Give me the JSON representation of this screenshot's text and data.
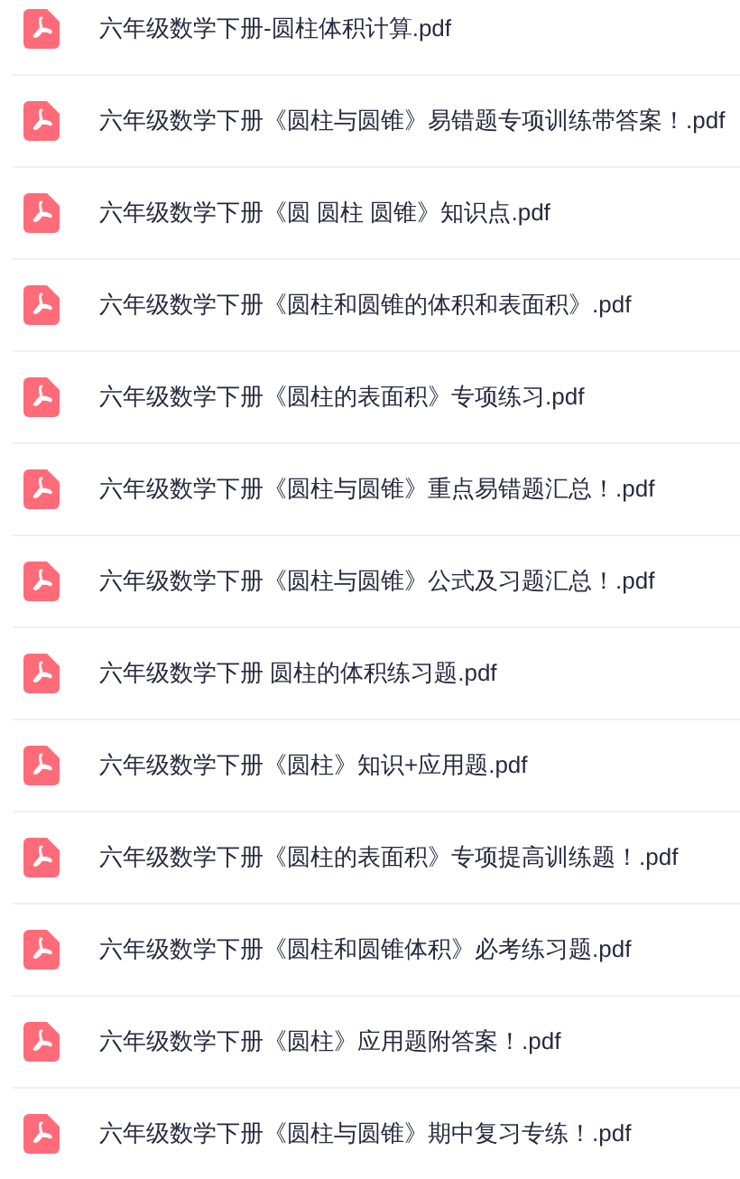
{
  "files": [
    {
      "name": "六年级数学下册-圆柱体积计算.pdf"
    },
    {
      "name": "六年级数学下册《圆柱与圆锥》易错题专项训练带答案！.pdf"
    },
    {
      "name": "六年级数学下册《圆 圆柱 圆锥》知识点.pdf"
    },
    {
      "name": "六年级数学下册《圆柱和圆锥的体积和表面积》.pdf"
    },
    {
      "name": "六年级数学下册《圆柱的表面积》专项练习.pdf"
    },
    {
      "name": "六年级数学下册《圆柱与圆锥》重点易错题汇总！.pdf"
    },
    {
      "name": "六年级数学下册《圆柱与圆锥》公式及习题汇总！.pdf"
    },
    {
      "name": "六年级数学下册 圆柱的体积练习题.pdf"
    },
    {
      "name": "六年级数学下册《圆柱》知识+应用题.pdf"
    },
    {
      "name": "六年级数学下册《圆柱的表面积》专项提高训练题！.pdf"
    },
    {
      "name": "六年级数学下册《圆柱和圆锥体积》必考练习题.pdf"
    },
    {
      "name": "六年级数学下册《圆柱》应用题附答案！.pdf"
    },
    {
      "name": "六年级数学下册《圆柱与圆锥》期中复习专练！.pdf"
    }
  ]
}
